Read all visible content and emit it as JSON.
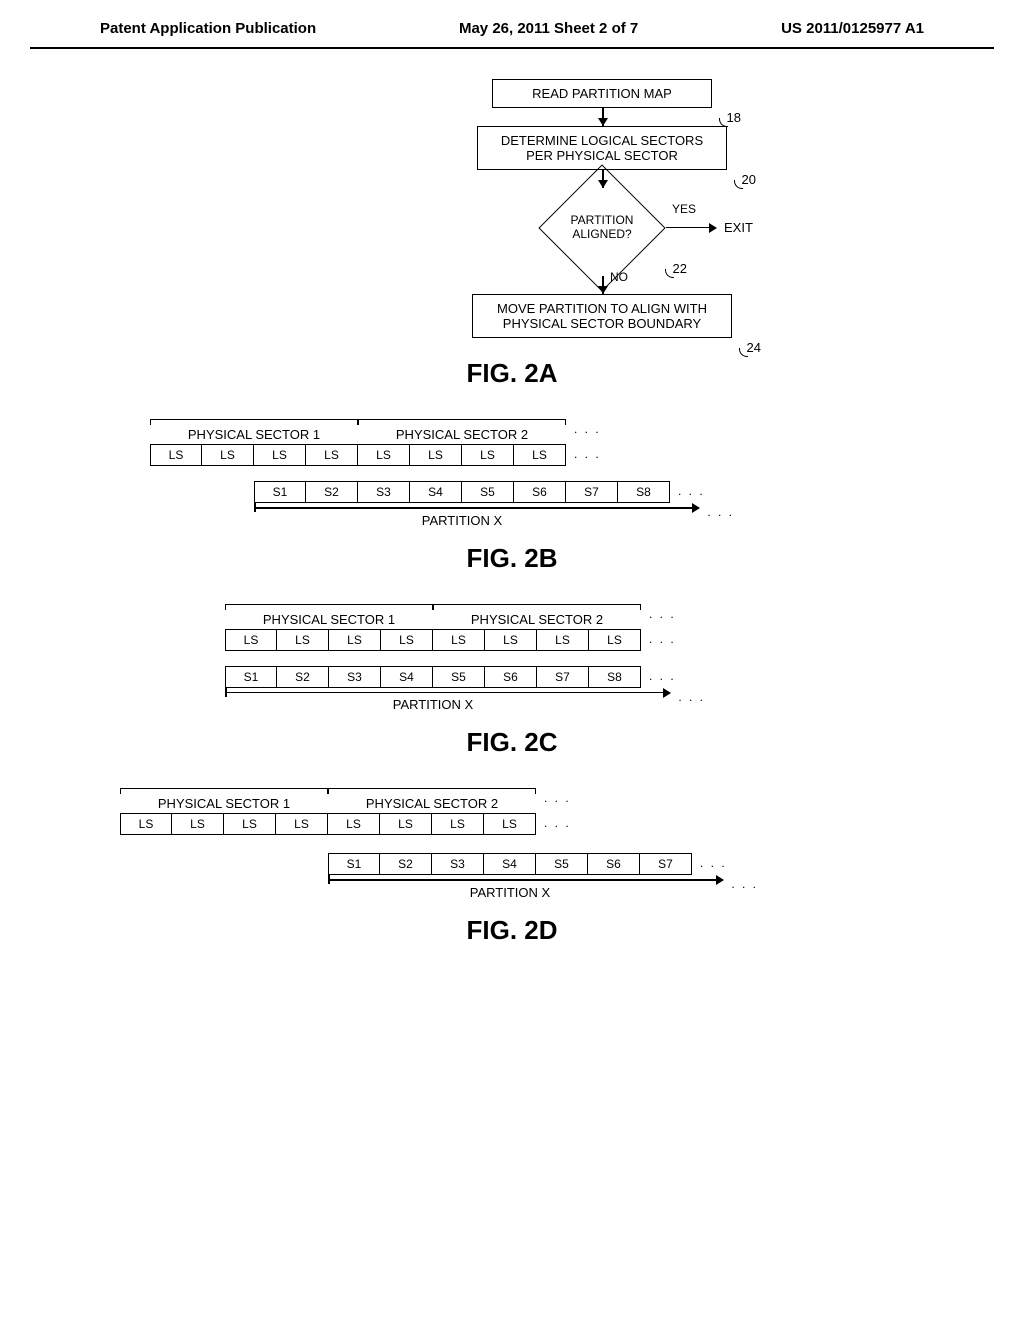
{
  "header": {
    "left": "Patent Application Publication",
    "center": "May 26, 2011  Sheet 2 of 7",
    "right": "US 2011/0125977 A1"
  },
  "flowchart": {
    "step1": {
      "text": "READ PARTITION MAP",
      "num": "18"
    },
    "step2": {
      "text_l1": "DETERMINE LOGICAL SECTORS",
      "text_l2": "PER PHYSICAL SECTOR",
      "num": "20"
    },
    "decision": {
      "text_l1": "PARTITION",
      "text_l2": "ALIGNED?",
      "num": "22",
      "yes": "YES",
      "no": "NO",
      "exit": "EXIT"
    },
    "step3": {
      "text_l1": "MOVE PARTITION TO ALIGN WITH",
      "text_l2": "PHYSICAL SECTOR BOUNDARY",
      "num": "24"
    }
  },
  "fig_labels": {
    "a": "FIG. 2A",
    "b": "FIG. 2B",
    "c": "FIG. 2C",
    "d": "FIG. 2D"
  },
  "sectors": {
    "phys1": "PHYSICAL SECTOR 1",
    "phys2": "PHYSICAL SECTOR 2",
    "ls": "LS",
    "partition": "PARTITION X",
    "dots": ". . .",
    "s": [
      "S1",
      "S2",
      "S3",
      "S4",
      "S5",
      "S6",
      "S7",
      "S8"
    ]
  }
}
